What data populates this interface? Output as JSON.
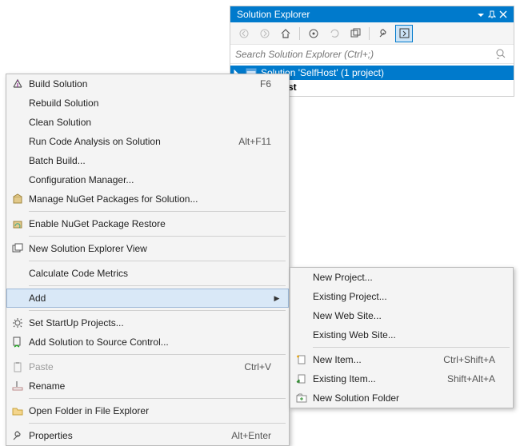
{
  "panel": {
    "title": "Solution Explorer",
    "search_placeholder": "Search Solution Explorer (Ctrl+;)",
    "items": [
      {
        "label": "Solution 'SelfHost' (1 project)"
      },
      {
        "label": "SelfHost"
      }
    ]
  },
  "context_menu_1": [
    {
      "type": "item",
      "name": "build-solution",
      "icon": "build-icon",
      "label": "Build Solution",
      "shortcut": "F6"
    },
    {
      "type": "item",
      "name": "rebuild-solution",
      "icon": "",
      "label": "Rebuild Solution",
      "shortcut": ""
    },
    {
      "type": "item",
      "name": "clean-solution",
      "icon": "",
      "label": "Clean Solution",
      "shortcut": ""
    },
    {
      "type": "item",
      "name": "run-code-analysis",
      "icon": "",
      "label": "Run Code Analysis on Solution",
      "shortcut": "Alt+F11"
    },
    {
      "type": "item",
      "name": "batch-build",
      "icon": "",
      "label": "Batch Build...",
      "shortcut": ""
    },
    {
      "type": "item",
      "name": "configuration-manager",
      "icon": "",
      "label": "Configuration Manager...",
      "shortcut": ""
    },
    {
      "type": "item",
      "name": "manage-nuget",
      "icon": "nuget-icon",
      "label": "Manage NuGet Packages for Solution...",
      "shortcut": ""
    },
    {
      "type": "sep"
    },
    {
      "type": "item",
      "name": "enable-nuget-restore",
      "icon": "nuget-restore-icon",
      "label": "Enable NuGet Package Restore",
      "shortcut": ""
    },
    {
      "type": "sep"
    },
    {
      "type": "item",
      "name": "new-solution-explorer-view",
      "icon": "window-icon",
      "label": "New Solution Explorer View",
      "shortcut": ""
    },
    {
      "type": "sep"
    },
    {
      "type": "item",
      "name": "calculate-code-metrics",
      "icon": "",
      "label": "Calculate Code Metrics",
      "shortcut": ""
    },
    {
      "type": "sep"
    },
    {
      "type": "item",
      "name": "add",
      "icon": "",
      "label": "Add",
      "shortcut": "",
      "submenu": true,
      "highlight": true
    },
    {
      "type": "sep"
    },
    {
      "type": "item",
      "name": "set-startup-projects",
      "icon": "gear-icon",
      "label": "Set StartUp Projects...",
      "shortcut": ""
    },
    {
      "type": "item",
      "name": "add-to-source-control",
      "icon": "source-control-icon",
      "label": "Add Solution to Source Control...",
      "shortcut": ""
    },
    {
      "type": "sep"
    },
    {
      "type": "item",
      "name": "paste",
      "icon": "paste-icon",
      "label": "Paste",
      "shortcut": "Ctrl+V",
      "disabled": true
    },
    {
      "type": "item",
      "name": "rename",
      "icon": "rename-icon",
      "label": "Rename",
      "shortcut": ""
    },
    {
      "type": "sep"
    },
    {
      "type": "item",
      "name": "open-in-file-explorer",
      "icon": "folder-open-icon",
      "label": "Open Folder in File Explorer",
      "shortcut": ""
    },
    {
      "type": "sep"
    },
    {
      "type": "item",
      "name": "properties",
      "icon": "wrench-icon",
      "label": "Properties",
      "shortcut": "Alt+Enter"
    }
  ],
  "context_menu_2": [
    {
      "type": "item",
      "name": "new-project",
      "icon": "",
      "label": "New Project...",
      "shortcut": ""
    },
    {
      "type": "item",
      "name": "existing-project",
      "icon": "",
      "label": "Existing Project...",
      "shortcut": ""
    },
    {
      "type": "item",
      "name": "new-web-site",
      "icon": "",
      "label": "New Web Site...",
      "shortcut": ""
    },
    {
      "type": "item",
      "name": "existing-web-site",
      "icon": "",
      "label": "Existing Web Site...",
      "shortcut": ""
    },
    {
      "type": "sep"
    },
    {
      "type": "item",
      "name": "new-item",
      "icon": "new-item-icon",
      "label": "New Item...",
      "shortcut": "Ctrl+Shift+A"
    },
    {
      "type": "item",
      "name": "existing-item",
      "icon": "existing-item-icon",
      "label": "Existing Item...",
      "shortcut": "Shift+Alt+A"
    },
    {
      "type": "item",
      "name": "new-solution-folder",
      "icon": "solution-folder-icon",
      "label": "New Solution Folder",
      "shortcut": ""
    }
  ]
}
